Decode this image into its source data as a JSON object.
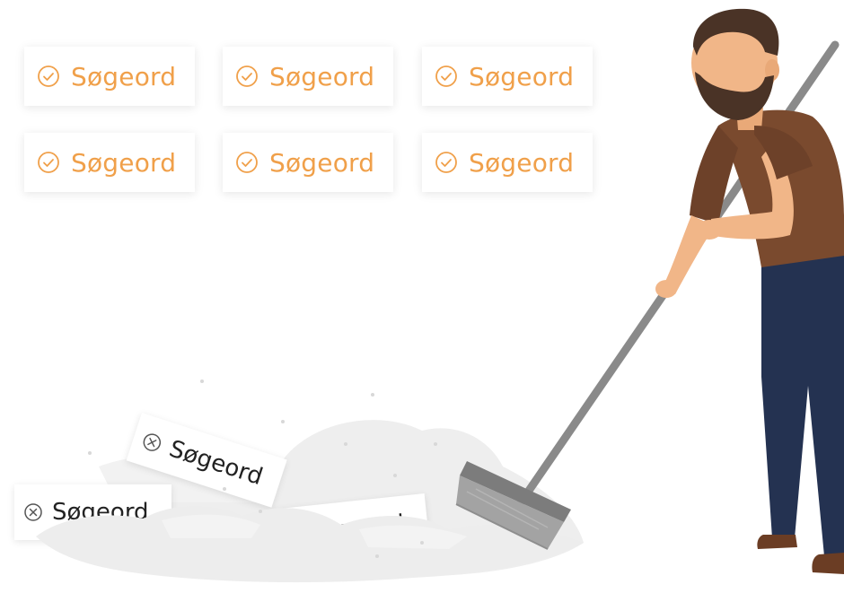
{
  "keywords": {
    "approved": [
      {
        "label": "Søgeord"
      },
      {
        "label": "Søgeord"
      },
      {
        "label": "Søgeord"
      },
      {
        "label": "Søgeord"
      },
      {
        "label": "Søgeord"
      },
      {
        "label": "Søgeord"
      }
    ],
    "rejected": [
      {
        "label": "Søgeord"
      },
      {
        "label": "Søgeord"
      },
      {
        "label": "Søgeord"
      }
    ]
  },
  "colors": {
    "accent": "#f0a04a",
    "shirt": "#7a4a2e",
    "pants": "#243251",
    "skin": "#f1b688",
    "hair": "#4a3326",
    "broom_handle": "#8a8a8a",
    "broom_head": "#9b9b9b",
    "dust": "#ececec"
  },
  "icons": {
    "approved": "check-circle-icon",
    "rejected": "x-circle-icon"
  }
}
